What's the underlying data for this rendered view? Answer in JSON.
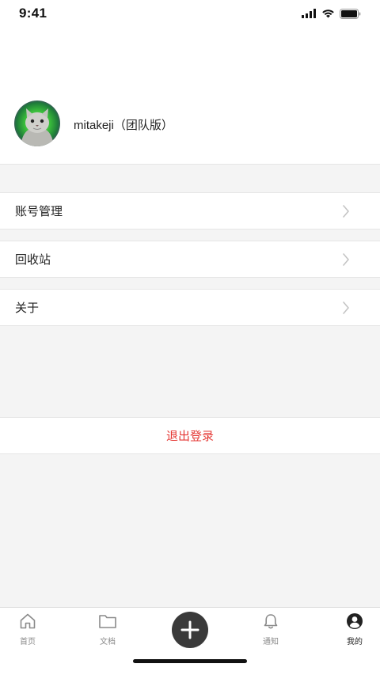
{
  "status_bar": {
    "time": "9:41"
  },
  "profile": {
    "username": "mitakeji（团队版）"
  },
  "menu": {
    "items": [
      {
        "label": "账号管理"
      },
      {
        "label": "回收站"
      },
      {
        "label": "关于"
      }
    ],
    "logout_label": "退出登录"
  },
  "tabbar": {
    "tabs": [
      {
        "label": "首页",
        "icon": "home-icon"
      },
      {
        "label": "文档",
        "icon": "folder-icon"
      },
      {
        "label": "",
        "icon": "plus-icon"
      },
      {
        "label": "通知",
        "icon": "bell-icon"
      },
      {
        "label": "我的",
        "icon": "profile-icon",
        "active": true
      }
    ]
  },
  "colors": {
    "logout": "#e53935",
    "add_button": "#3a3a3a",
    "background": "#f4f4f4"
  }
}
